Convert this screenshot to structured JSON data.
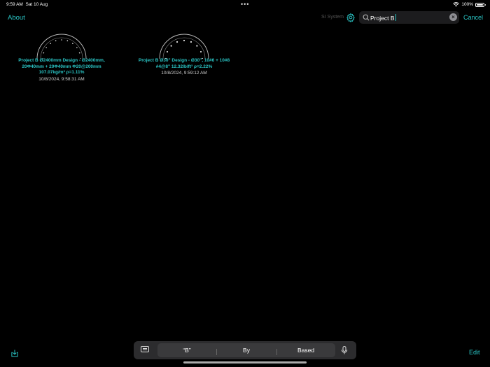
{
  "status_bar": {
    "time": "9:59 AM",
    "date": "Sat 10 Aug",
    "battery": "100%",
    "battery_level": 1.0
  },
  "nav": {
    "about_label": "About",
    "unit_system_label": "SI System",
    "search_value": "Project B",
    "cancel_label": "Cancel"
  },
  "designs": [
    {
      "title": "Project B Ø2400mm Design - Ø2400mm,\n20Φ40mm + 20Φ40mm Φ20@200mm\n107.07kg/m³ ρ=1.11%",
      "date": "10/8/2024, 9:58:31 AM"
    },
    {
      "title": "Project B Ø30\" Design - Ø30\", 10#6 + 10#8\n#4@8\" 12.32lb/ft³ ρ=2.22%",
      "date": "10/8/2024, 9:59:12 AM"
    }
  ],
  "toolbar": {
    "edit_label": "Edit"
  },
  "keyboard": {
    "suggestions": [
      "“B”",
      "By",
      "Based"
    ]
  },
  "colors": {
    "accent": "#2ac6c6",
    "background": "#000000"
  }
}
